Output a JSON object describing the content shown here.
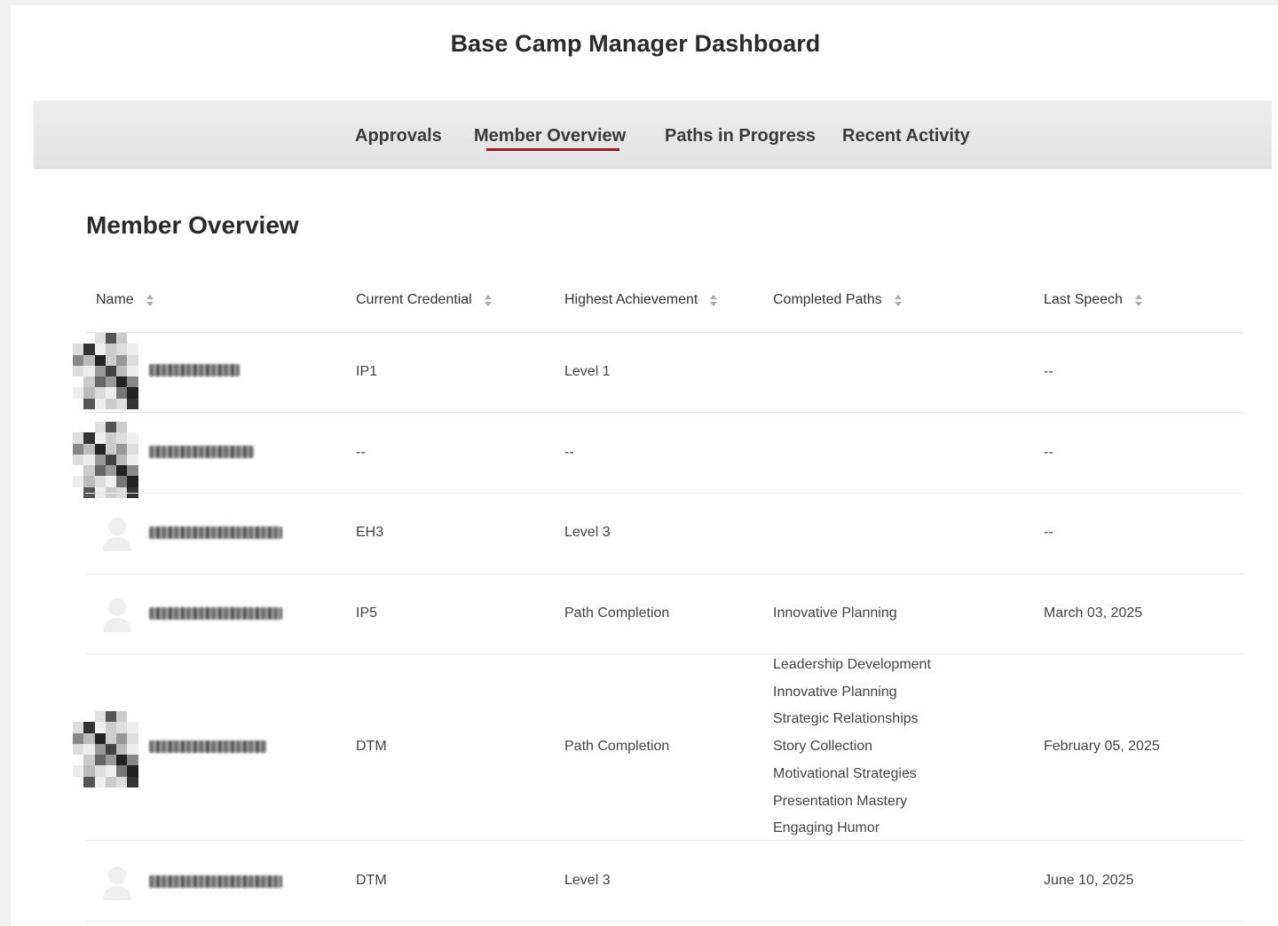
{
  "dashboard": {
    "title": "Base Camp Manager Dashboard"
  },
  "tabs": [
    {
      "label": "Approvals",
      "active": false
    },
    {
      "label": "Member Overview",
      "active": true
    },
    {
      "label": "Paths in Progress",
      "active": false
    },
    {
      "label": "Recent Activity",
      "active": false
    }
  ],
  "colors": {
    "accent": "#9b1c31",
    "tabbar_bg": "#e6e6e6"
  },
  "section": {
    "title": "Member Overview"
  },
  "table": {
    "columns": [
      "Name",
      "Current Credential",
      "Highest Achievement",
      "Completed Paths",
      "Last Speech"
    ],
    "rows": [
      {
        "name": "",
        "avatar": "pixelated-photo",
        "credential": "IP1",
        "achievement": "Level 1",
        "paths": [],
        "last_speech": "--"
      },
      {
        "name": "",
        "avatar": "pixelated-photo",
        "credential": "--",
        "achievement": "--",
        "paths": [],
        "last_speech": "--"
      },
      {
        "name": "",
        "avatar": "default-user-icon",
        "credential": "EH3",
        "achievement": "Level 3",
        "paths": [],
        "last_speech": "--"
      },
      {
        "name": "",
        "avatar": "default-user-icon",
        "credential": "IP5",
        "achievement": "Path Completion",
        "paths": [
          "Innovative Planning"
        ],
        "last_speech": "March 03, 2025"
      },
      {
        "name": "",
        "avatar": "pixelated-photo",
        "credential": "DTM",
        "achievement": "Path Completion",
        "paths": [
          "Leadership Development",
          "Innovative Planning",
          "Strategic Relationships",
          "Story Collection",
          "Motivational Strategies",
          "Presentation Mastery",
          "Engaging Humor"
        ],
        "last_speech": "February 05, 2025"
      },
      {
        "name": "",
        "avatar": "default-user-icon",
        "credential": "DTM",
        "achievement": "Level 3",
        "paths": [],
        "last_speech": "June 10, 2025"
      }
    ]
  }
}
